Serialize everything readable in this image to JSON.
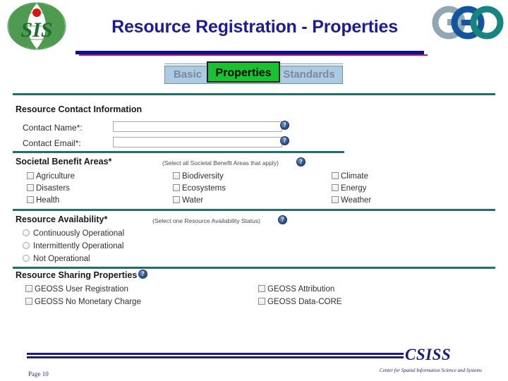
{
  "slide": {
    "title": "Resource Registration - Properties",
    "logo_left_text": "SIS",
    "logo_right_text": "GEO"
  },
  "tabs": [
    {
      "label": "Basic",
      "selected": false
    },
    {
      "label": "Properties",
      "selected": true
    },
    {
      "label": "Standards",
      "selected": false
    }
  ],
  "contact_section": {
    "title": "Resource Contact Information",
    "fields": [
      {
        "label": "Contact Name*:",
        "value": "",
        "placeholder": ""
      },
      {
        "label": "Contact Email*:",
        "value": "",
        "placeholder": ""
      }
    ],
    "help_icon": "help-question-icon"
  },
  "sba_section": {
    "title": "Societal Benefit Areas*",
    "hint": "(Select all Societal Benefit Areas that apply)",
    "columns": [
      {
        "items": [
          {
            "label": "Agriculture",
            "checked": false
          },
          {
            "label": "Disasters",
            "checked": false
          },
          {
            "label": "Health",
            "checked": false
          }
        ]
      },
      {
        "items": [
          {
            "label": "Biodiversity",
            "checked": false
          },
          {
            "label": "Ecosystems",
            "checked": false
          },
          {
            "label": "Water",
            "checked": false
          }
        ]
      },
      {
        "items": [
          {
            "label": "Climate",
            "checked": false
          },
          {
            "label": "Energy",
            "checked": false
          },
          {
            "label": "Weather",
            "checked": false
          }
        ]
      }
    ]
  },
  "availability_section": {
    "title": "Resource Availability*",
    "hint": "(Select one Resource Availability Status)",
    "options": [
      {
        "label": "Continuously Operational",
        "selected": false
      },
      {
        "label": "Intermittently Operational",
        "selected": false
      },
      {
        "label": "Not Operational",
        "selected": false
      }
    ]
  },
  "sharing_section": {
    "title": "Resource Sharing Properties",
    "columns": [
      {
        "items": [
          {
            "label": "GEOSS User Registration",
            "checked": false
          },
          {
            "label": "GEOSS No Monetary Charge",
            "checked": false
          }
        ]
      },
      {
        "items": [
          {
            "label": "GEOSS Attribution",
            "checked": false
          },
          {
            "label": "GEOSS Data-CORE",
            "checked": false
          }
        ]
      }
    ]
  },
  "footer": {
    "brand": "CSISS",
    "tagline": "Center for Spatial Information Science and Systems",
    "page": "Page  10"
  },
  "colors": {
    "title_blue": "#1d1d8f",
    "rule_navy": "#12127a",
    "rule_crimson": "#c2185b",
    "section_rule_teal": "#2d6a68",
    "tab_inactive_bg": "#aacbe3",
    "tab_active_bg": "#18c231",
    "help_icon_blue": "#33568f"
  }
}
